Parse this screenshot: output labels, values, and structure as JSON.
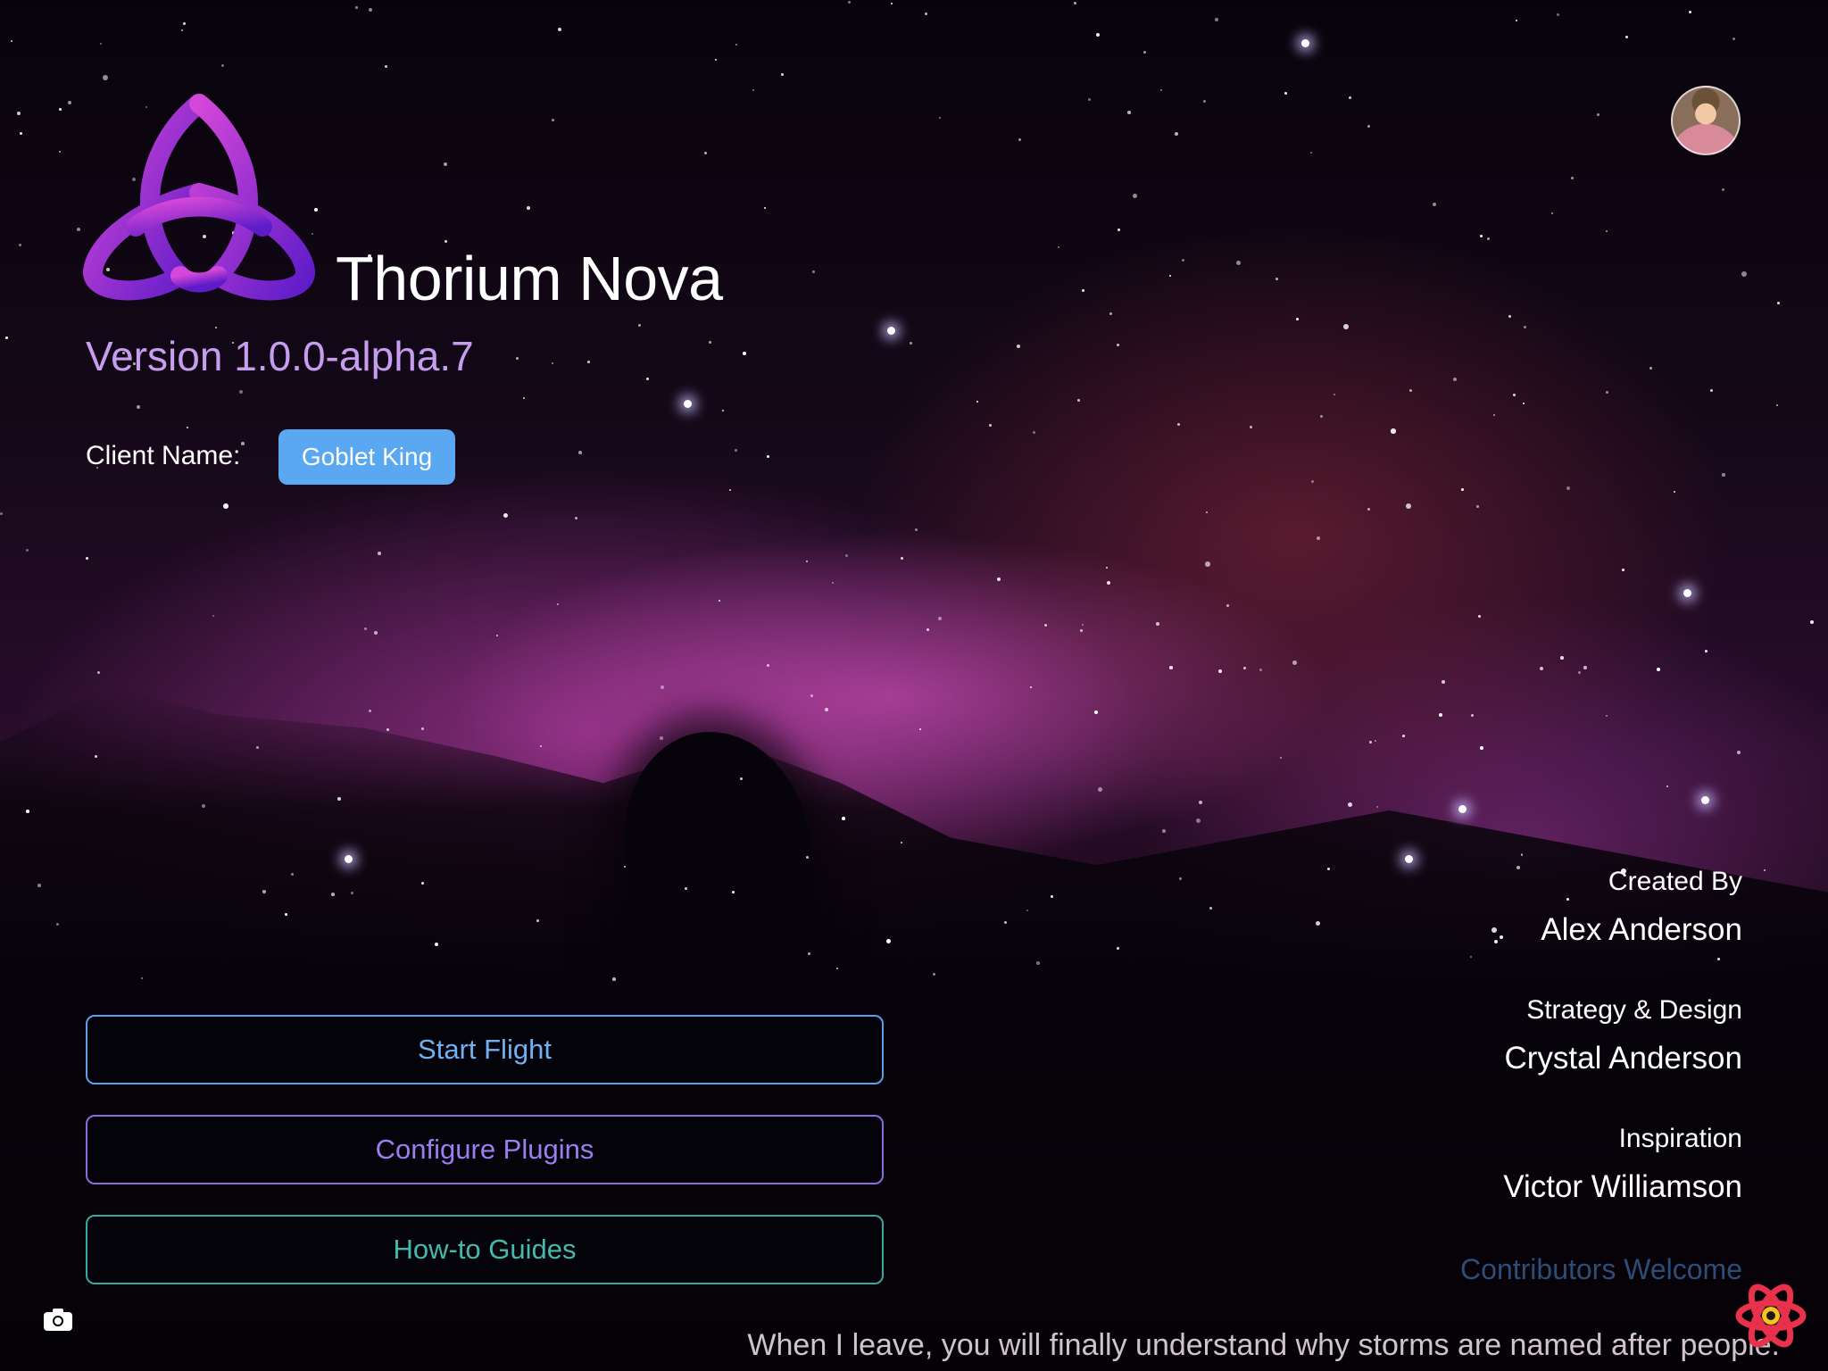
{
  "app": {
    "title": "Thorium Nova",
    "version": "Version 1.0.0-alpha.7",
    "client_label": "Client Name:",
    "client_name": "Goblet King"
  },
  "menu": {
    "start_flight": "Start Flight",
    "configure_plugins": "Configure Plugins",
    "how_to_guides": "How-to Guides"
  },
  "credits": [
    {
      "role": "Created By",
      "name": "Alex Anderson"
    },
    {
      "role": "Strategy & Design",
      "name": "Crystal Anderson"
    },
    {
      "role": "Inspiration",
      "name": "Victor Williamson"
    }
  ],
  "contributors": "Contributors Welcome",
  "quote": "When I leave, you will finally understand why storms are named after people.",
  "icons": {
    "logo": "triquetra-logo",
    "avatar": "user-avatar",
    "camera": "camera-icon",
    "devtools": "react-devtools-icon"
  },
  "colors": {
    "logo_gradient_start": "#c53ad8",
    "logo_gradient_end": "#6a1fd0",
    "version": "#c79df0",
    "client_badge": "#5aa8f2",
    "start_flight": "#5d9fea",
    "configure_plugins": "#8a6be0",
    "how_to_guides": "#3aa79e"
  }
}
